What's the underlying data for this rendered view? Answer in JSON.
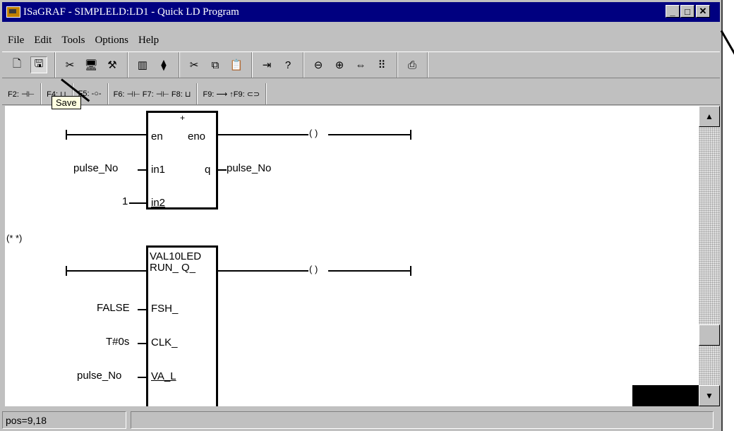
{
  "window": {
    "title": "ISaGRAF - SIMPLELD:LD1 - Quick LD Program",
    "controls": [
      "minimize",
      "maximize",
      "close"
    ]
  },
  "menu": [
    "File",
    "Edit",
    "Tools",
    "Options",
    "Help"
  ],
  "toolbar": {
    "groups": [
      [
        {
          "icon": "new-icon",
          "glyph": "🗋"
        },
        {
          "icon": "save-icon",
          "glyph": "🖫",
          "pressed": true
        }
      ],
      [
        {
          "icon": "cut-icon",
          "glyph": "✂"
        },
        {
          "icon": "monitor-icon",
          "glyph": "🖥"
        },
        {
          "icon": "tool-icon",
          "glyph": "⚒"
        }
      ],
      [
        {
          "icon": "library-icon",
          "glyph": "▥"
        },
        {
          "icon": "network-icon",
          "glyph": "⧫"
        }
      ],
      [
        {
          "icon": "scissors-icon",
          "glyph": "✂"
        },
        {
          "icon": "copy-icon",
          "glyph": "⧉"
        },
        {
          "icon": "paste-icon",
          "glyph": "📋"
        }
      ],
      [
        {
          "icon": "enter-icon",
          "glyph": "⇥"
        },
        {
          "icon": "contact-question-icon",
          "glyph": "?"
        }
      ],
      [
        {
          "icon": "zoom-out-icon",
          "glyph": "⊖"
        },
        {
          "icon": "zoom-in-icon",
          "glyph": "⊕"
        },
        {
          "icon": "fit-icon",
          "glyph": "⇔"
        },
        {
          "icon": "grid-icon",
          "glyph": "⠿"
        }
      ],
      [
        {
          "icon": "print-icon",
          "glyph": "⎙"
        }
      ]
    ]
  },
  "ld_toolbar": {
    "items": [
      "F2: ⊣⊢",
      "F4: ⊔",
      "F5: -○-",
      "F6: ⊣⊢  F7: ⊣⊢  F8: ⊔",
      "F9: ⟶  ↑F9: ⊂⊃"
    ]
  },
  "tooltip": "Save",
  "diagram": {
    "block1": {
      "plus": "+",
      "pins_left": [
        "en",
        "in1",
        "in2"
      ],
      "pins_right": [
        "eno",
        "q"
      ],
      "inputs": [
        "pulse_No",
        "1"
      ],
      "output": "pulse_No"
    },
    "comment": "(* *)",
    "block2": {
      "title": "VAL10LED",
      "pin_right": "RUN_ Q_",
      "pins_left": [
        "FSH_",
        "CLK_",
        "VA_L"
      ],
      "inputs": [
        "FALSE",
        "T#0s",
        "pulse_No"
      ]
    },
    "coil_symbol": "( )"
  },
  "status": {
    "pos": "pos=9,18",
    "message": ""
  }
}
